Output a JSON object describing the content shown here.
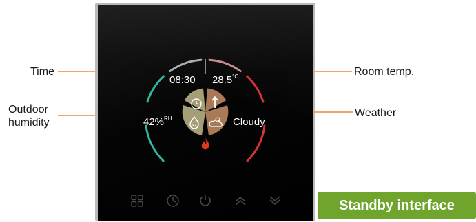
{
  "display": {
    "time": "08:30",
    "room_temp": "28.5",
    "room_temp_unit": "°C",
    "humidity": "42%",
    "humidity_unit": "RH",
    "weather": "Cloudy"
  },
  "callouts": {
    "time": "Time",
    "room_temp": "Room temp.",
    "outdoor_humidity_line1": "Outdoor",
    "outdoor_humidity_line2": "humidity",
    "weather": "Weather"
  },
  "badge": {
    "label": "Standby interface"
  },
  "icons": {
    "center_top_left": "clock-icon",
    "center_top_right": "thermometer-icon",
    "center_bottom_left": "humidity-drop-icon",
    "center_bottom_right": "sun-cloud-icon",
    "heating": "flame-icon",
    "buttons": [
      "grid-menu-icon",
      "clock-icon",
      "power-icon",
      "chevron-up-icon",
      "chevron-down-icon"
    ]
  },
  "colors": {
    "arc_teal": "#2fb5a0",
    "arc_red": "#d9323a",
    "arc_top_gray": "#a7b0ae",
    "arc_top_rose": "#c48f8d",
    "sector_left": "#a59e77",
    "sector_right": "#a87a58",
    "flame": "#e03a1e",
    "badge": "#6fa52c",
    "leader": "#f2a474"
  }
}
